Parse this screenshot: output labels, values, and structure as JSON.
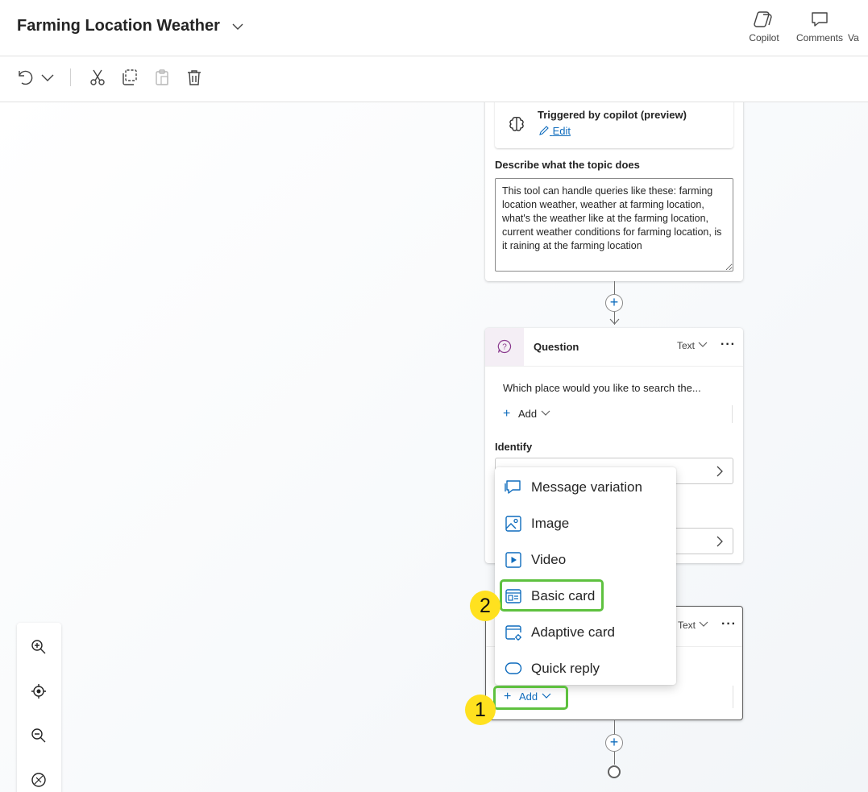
{
  "header": {
    "title": "Farming Location Weather",
    "buttons": [
      {
        "label": "Copilot",
        "icon": "copilot-icon"
      },
      {
        "label": "Comments",
        "icon": "comment-icon"
      },
      {
        "label": "Va",
        "icon": "variables-icon"
      }
    ]
  },
  "toolbar": {
    "icons": [
      "undo-icon",
      "chevron-down-icon",
      "cut-icon",
      "copy-icon",
      "paste-icon",
      "delete-icon"
    ]
  },
  "trigger_card": {
    "trigger_label": "Triggered by copilot (preview)",
    "edit_label": "Edit",
    "describe_label": "Describe what the topic does",
    "description": "This tool can handle queries like these: farming location weather, weather at farming location, what's the weather like at the farming location, current weather conditions for farming location, is it raining at the farming location"
  },
  "question_card": {
    "title": "Question",
    "type_label": "Text",
    "prompt": "Which place would you like to search the...",
    "add_label": "Add",
    "identify_label": "Identify"
  },
  "message_card": {
    "type_label": "Text",
    "add_label": "Add"
  },
  "add_menu": {
    "items": [
      {
        "label": "Message variation",
        "icon": "message-variation-icon"
      },
      {
        "label": "Image",
        "icon": "image-icon"
      },
      {
        "label": "Video",
        "icon": "video-icon"
      },
      {
        "label": "Basic card",
        "icon": "basic-card-icon"
      },
      {
        "label": "Adaptive card",
        "icon": "adaptive-card-icon"
      },
      {
        "label": "Quick reply",
        "icon": "quick-reply-icon"
      }
    ]
  },
  "annotations": {
    "step1": "1",
    "step2": "2",
    "highlight_color": "#5ec13f",
    "badge_color": "#ffe11f"
  },
  "colors": {
    "accent": "#0f6cbd",
    "question_icon_bg": "#f4eef5",
    "question_icon_color": "#8a3a8e"
  },
  "zoom_controls": [
    "zoom-in-icon",
    "recenter-icon",
    "zoom-out-icon",
    "minimap-icon"
  ]
}
